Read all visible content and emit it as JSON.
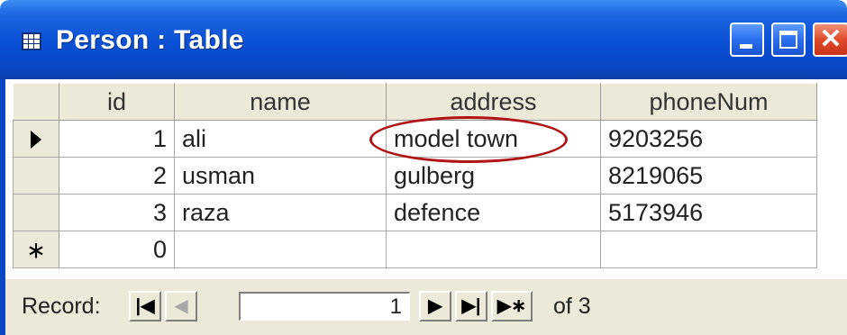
{
  "window": {
    "title": "Person : Table",
    "controls": {
      "minimize": "minimize",
      "maximize": "maximize",
      "close": "close"
    }
  },
  "table": {
    "columns": [
      "id",
      "name",
      "address",
      "phoneNum"
    ],
    "rows": [
      {
        "id": "1",
        "name": "ali",
        "address": "model town",
        "phoneNum": "9203256"
      },
      {
        "id": "2",
        "name": "usman",
        "address": "gulberg",
        "phoneNum": "8219065"
      },
      {
        "id": "3",
        "name": "raza",
        "address": "defence",
        "phoneNum": "5173946"
      }
    ],
    "new_row": {
      "selector": "∗",
      "id": "0"
    },
    "current_row_indicator": "▶"
  },
  "annotation": {
    "color": "#b01414"
  },
  "navigation": {
    "label": "Record:",
    "current_record": "1",
    "of_text": "of 3",
    "icons": {
      "first": "|◀",
      "prev": "◀",
      "next": "▶",
      "last": "▶|",
      "new": "▶∗"
    }
  },
  "colors": {
    "titlebar": "#0a4fd4",
    "close_button": "#e04b2a",
    "frame": "#ece9d8",
    "annotation": "#b01414"
  }
}
